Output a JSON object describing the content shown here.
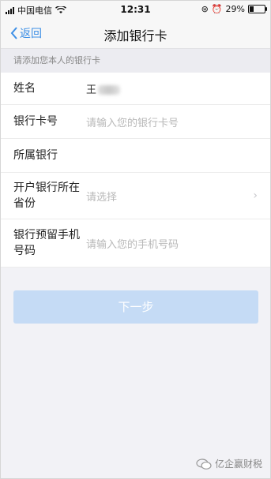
{
  "status_bar": {
    "carrier": "中国电信",
    "time": "12:31",
    "battery": "29%",
    "battery_level": 0.29
  },
  "nav": {
    "back_label": "返回",
    "title": "添加银行卡"
  },
  "hint": "请添加您本人的银行卡",
  "form": {
    "name": {
      "label": "姓名",
      "value": "王"
    },
    "card_no": {
      "label": "银行卡号",
      "placeholder": "请输入您的银行卡号"
    },
    "bank": {
      "label": "所属银行",
      "value": ""
    },
    "province": {
      "label_line1": "开户银行所在",
      "label_line2": "省份",
      "placeholder": "请选择"
    },
    "phone": {
      "label_line1": "银行预留手机",
      "label_line2": "号码",
      "placeholder": "请输入您的手机号码"
    }
  },
  "next_button": "下一步",
  "watermark": "亿企赢财税"
}
